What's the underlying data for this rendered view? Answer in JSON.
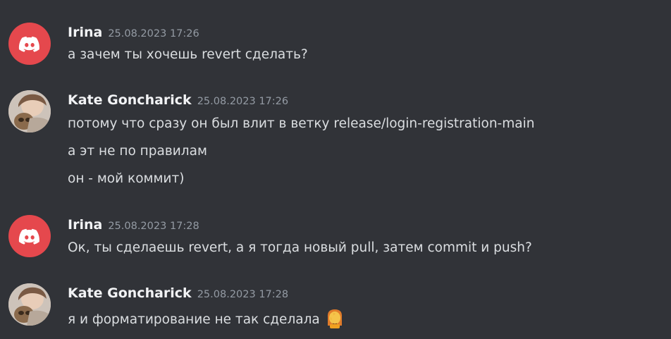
{
  "messages": [
    {
      "author": "Irina",
      "timestamp": "25.08.2023 17:26",
      "avatar": "discord-logo-icon",
      "lines": [
        "а зачем ты хочешь revert сделать?"
      ]
    },
    {
      "author": "Kate Goncharick",
      "timestamp": "25.08.2023 17:26",
      "avatar": "user-photo-avatar",
      "lines": [
        "потому что сразу он был влит в ветку release/login-registration-main",
        "а эт не по правилам",
        "он - мой коммит)"
      ]
    },
    {
      "author": "Irina",
      "timestamp": "25.08.2023 17:28",
      "avatar": "discord-logo-icon",
      "lines": [
        "Ок, ты сделаешь revert, а я тогда новый pull, затем commit и push?"
      ]
    },
    {
      "author": "Kate Goncharick",
      "timestamp": "25.08.2023 17:28",
      "avatar": "user-photo-avatar",
      "lines": [
        "я и форматирование не так сделала"
      ],
      "emoji": "facepalm-emoji"
    }
  ],
  "colors": {
    "background": "#313338",
    "author": "#f2f3f5",
    "timestamp": "#949ba4",
    "text": "#dbdee1",
    "discord_avatar": "#e5484d"
  }
}
